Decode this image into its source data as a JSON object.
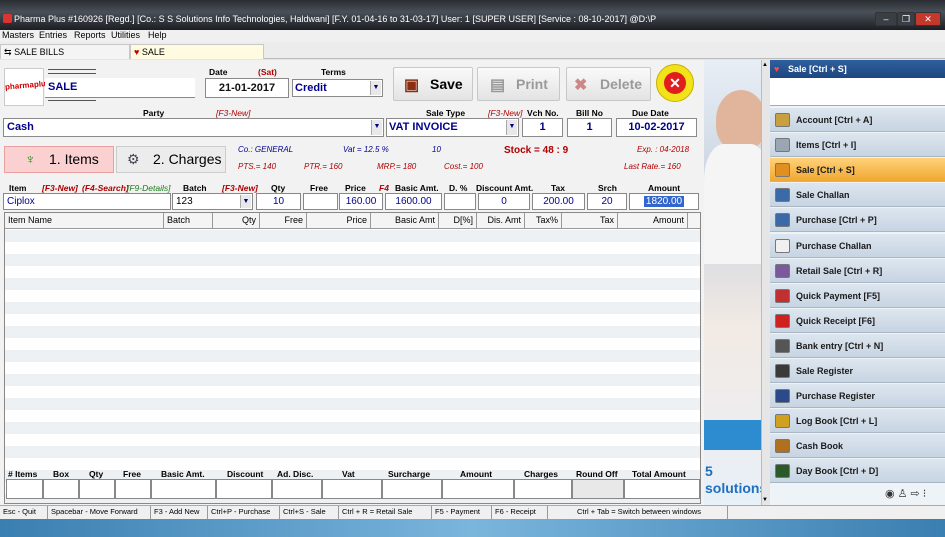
{
  "window": {
    "title": "Pharma Plus #160926  [Regd.]  [Co.: S S Solutions Info Technologies, Haldwani] [F.Y. 01-04-16 to 31-03-17] User: 1 [SUPER USER]  [Service : 08-10-2017]  @D:\\P"
  },
  "menu": [
    "Masters",
    "Entries",
    "Reports",
    "Utilities",
    "Help"
  ],
  "tabs": [
    "SALE BILLS",
    "SALE"
  ],
  "form": {
    "logo": "pharmaplus",
    "doc_type": "SALE",
    "date_label": "Date",
    "day": "(Sat)",
    "date": "21-01-2017",
    "terms_label": "Terms",
    "terms": "Credit",
    "save": "Save",
    "print": "Print",
    "delete": "Delete",
    "party_label": "Party",
    "party_hint": "[F3-New]",
    "party": "Cash",
    "sale_type_label": "Sale Type",
    "sale_type_hint": "[F3-New]",
    "sale_type": "VAT INVOICE",
    "vch_label": "Vch No.",
    "vch": "1",
    "bill_label": "Bill No",
    "bill": "1",
    "due_label": "Due Date",
    "due": "10-02-2017",
    "items_btn": "1. Items",
    "charges_btn": "2. Charges",
    "co": "Co.: GENERAL",
    "vat": "Vat = 12.5 %",
    "ten": "10",
    "stock": "Stock = 48 : 9",
    "exp": "Exp. : 04-2018",
    "pts": "PTS.= 140",
    "ptr": "PTR.= 160",
    "f4": "F4",
    "mrp": "MRP.= 180",
    "cost": "Cost.= 100",
    "last_rate": "Last Rate.= 160"
  },
  "entry": {
    "hdr": {
      "item": "Item",
      "hint1": "[F3-New]",
      "hint2": "(F4-Search)",
      "hint3": "[F9-Details]",
      "batch": "Batch",
      "hint4": "[F3-New]",
      "qty": "Qty",
      "free": "Free",
      "price": "Price",
      "f4": "F4",
      "basic": "Basic Amt.",
      "disc": "D. %",
      "discamt": "Discount Amt.",
      "tax": "Tax",
      "srch": "Srch",
      "amount": "Amount"
    },
    "vals": {
      "item": "Ciplox",
      "batch": "123",
      "qty": "10",
      "free": "",
      "price": "160.00",
      "basic": "1600.00",
      "disc": "",
      "discamt": "0",
      "tax": "200.00",
      "srch": "20",
      "amount": "1820.00"
    }
  },
  "grid": {
    "columns": [
      "Item Name",
      "Batch",
      "Qty",
      "Free",
      "Price",
      "Basic Amt",
      "D[%]",
      "Dis. Amt",
      "Tax%",
      "Tax",
      "Amount"
    ]
  },
  "footer": {
    "labels": [
      "# Items",
      "Box",
      "Qty",
      "Free",
      "Basic Amt.",
      "Discount",
      "Ad. Disc.",
      "Vat",
      "Surcharge",
      "Amount",
      "Charges",
      "Round Off",
      "Total Amount"
    ]
  },
  "status": [
    "Esc - Quit",
    "Spacebar - Move Forward",
    "F3 - Add New",
    "Ctrl+P - Purchase",
    "Ctrl+S - Sale",
    "Ctrl + R = Retail Sale",
    "F5 - Payment",
    "F6 - Receipt",
    "Ctrl + Tab = Switch between windows"
  ],
  "photo_text": {
    "num": "5",
    "word": "solutions"
  },
  "panel": {
    "title": "Sale [Ctrl + S]",
    "items": [
      {
        "label": "Account [Ctrl + A]",
        "icon": "account-icon",
        "color": "#c8a040"
      },
      {
        "label": "Items [Ctrl + I]",
        "icon": "items-icon",
        "color": "#9aa6b4"
      },
      {
        "label": "Sale [Ctrl + S]",
        "icon": "sale-icon",
        "color": "#e09020",
        "active": true
      },
      {
        "label": "Sale Challan",
        "icon": "challan-icon",
        "color": "#3a6aa8"
      },
      {
        "label": "Purchase [Ctrl + P]",
        "icon": "purchase-icon",
        "color": "#3a6aa8"
      },
      {
        "label": "Purchase Challan",
        "icon": "document-icon",
        "color": "#f0f0f0"
      },
      {
        "label": "Retail Sale [Ctrl + R]",
        "icon": "retail-icon",
        "color": "#7a5a9a"
      },
      {
        "label": "Quick Payment [F5]",
        "icon": "payment-icon",
        "color": "#c03030"
      },
      {
        "label": "Quick Receipt [F6]",
        "icon": "heart-icon",
        "color": "#d02020"
      },
      {
        "label": "Bank entry [Ctrl + N]",
        "icon": "bank-icon",
        "color": "#555555"
      },
      {
        "label": "Sale Register",
        "icon": "register-icon",
        "color": "#3a3a3a"
      },
      {
        "label": "Purchase Register",
        "icon": "book-icon",
        "color": "#2a4a8a"
      },
      {
        "label": "Log Book [Ctrl + L]",
        "icon": "log-icon",
        "color": "#d0a020"
      },
      {
        "label": "Cash Book",
        "icon": "cash-icon",
        "color": "#b07020"
      },
      {
        "label": "Day Book [Ctrl + D]",
        "icon": "daybook-icon",
        "color": "#2a5a2a"
      }
    ]
  }
}
